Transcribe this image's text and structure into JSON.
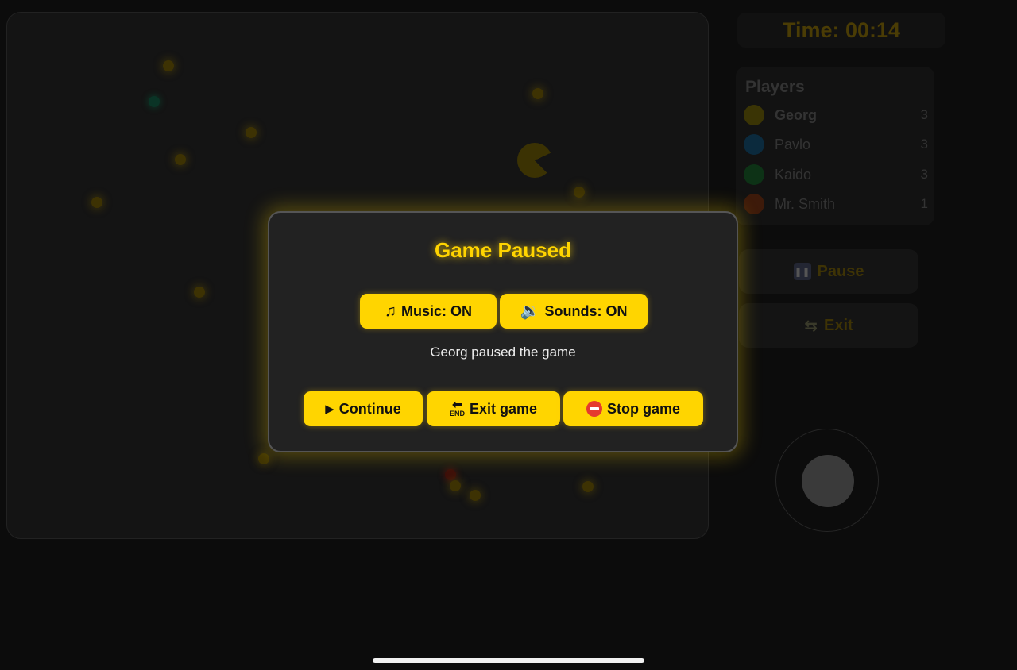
{
  "timer": {
    "label": "Time: 00:14"
  },
  "players": {
    "title": "Players",
    "list": [
      {
        "name": "Georg",
        "score": "3",
        "color": "#3a3405",
        "is_self": true
      },
      {
        "name": "Pavlo",
        "score": "3",
        "color": "#0b2a3d",
        "is_self": false
      },
      {
        "name": "Kaido",
        "score": "3",
        "color": "#0d3216",
        "is_self": false
      },
      {
        "name": "Mr. Smith",
        "score": "1",
        "color": "#3d1a0a",
        "is_self": false
      }
    ]
  },
  "side_controls": {
    "pause_label": "Pause",
    "pause_icon": "pause-icon",
    "exit_label": "Exit",
    "exit_icon": "back-arrows-icon"
  },
  "modal": {
    "title": "Game Paused",
    "music_label": "Music: ON",
    "music_icon": "music-note-icon",
    "sounds_label": "Sounds: ON",
    "sounds_icon": "speaker-icon",
    "message": "Georg paused the game",
    "continue_label": "Continue",
    "continue_icon": "play-icon",
    "exit_game_label": "Exit game",
    "exit_game_icon": "end-arrow-icon",
    "stop_game_label": "Stop game",
    "stop_game_icon": "no-entry-icon"
  },
  "colors": {
    "accent": "#ffd500",
    "background": "#0c0c0c",
    "modal_background": "#222222"
  }
}
